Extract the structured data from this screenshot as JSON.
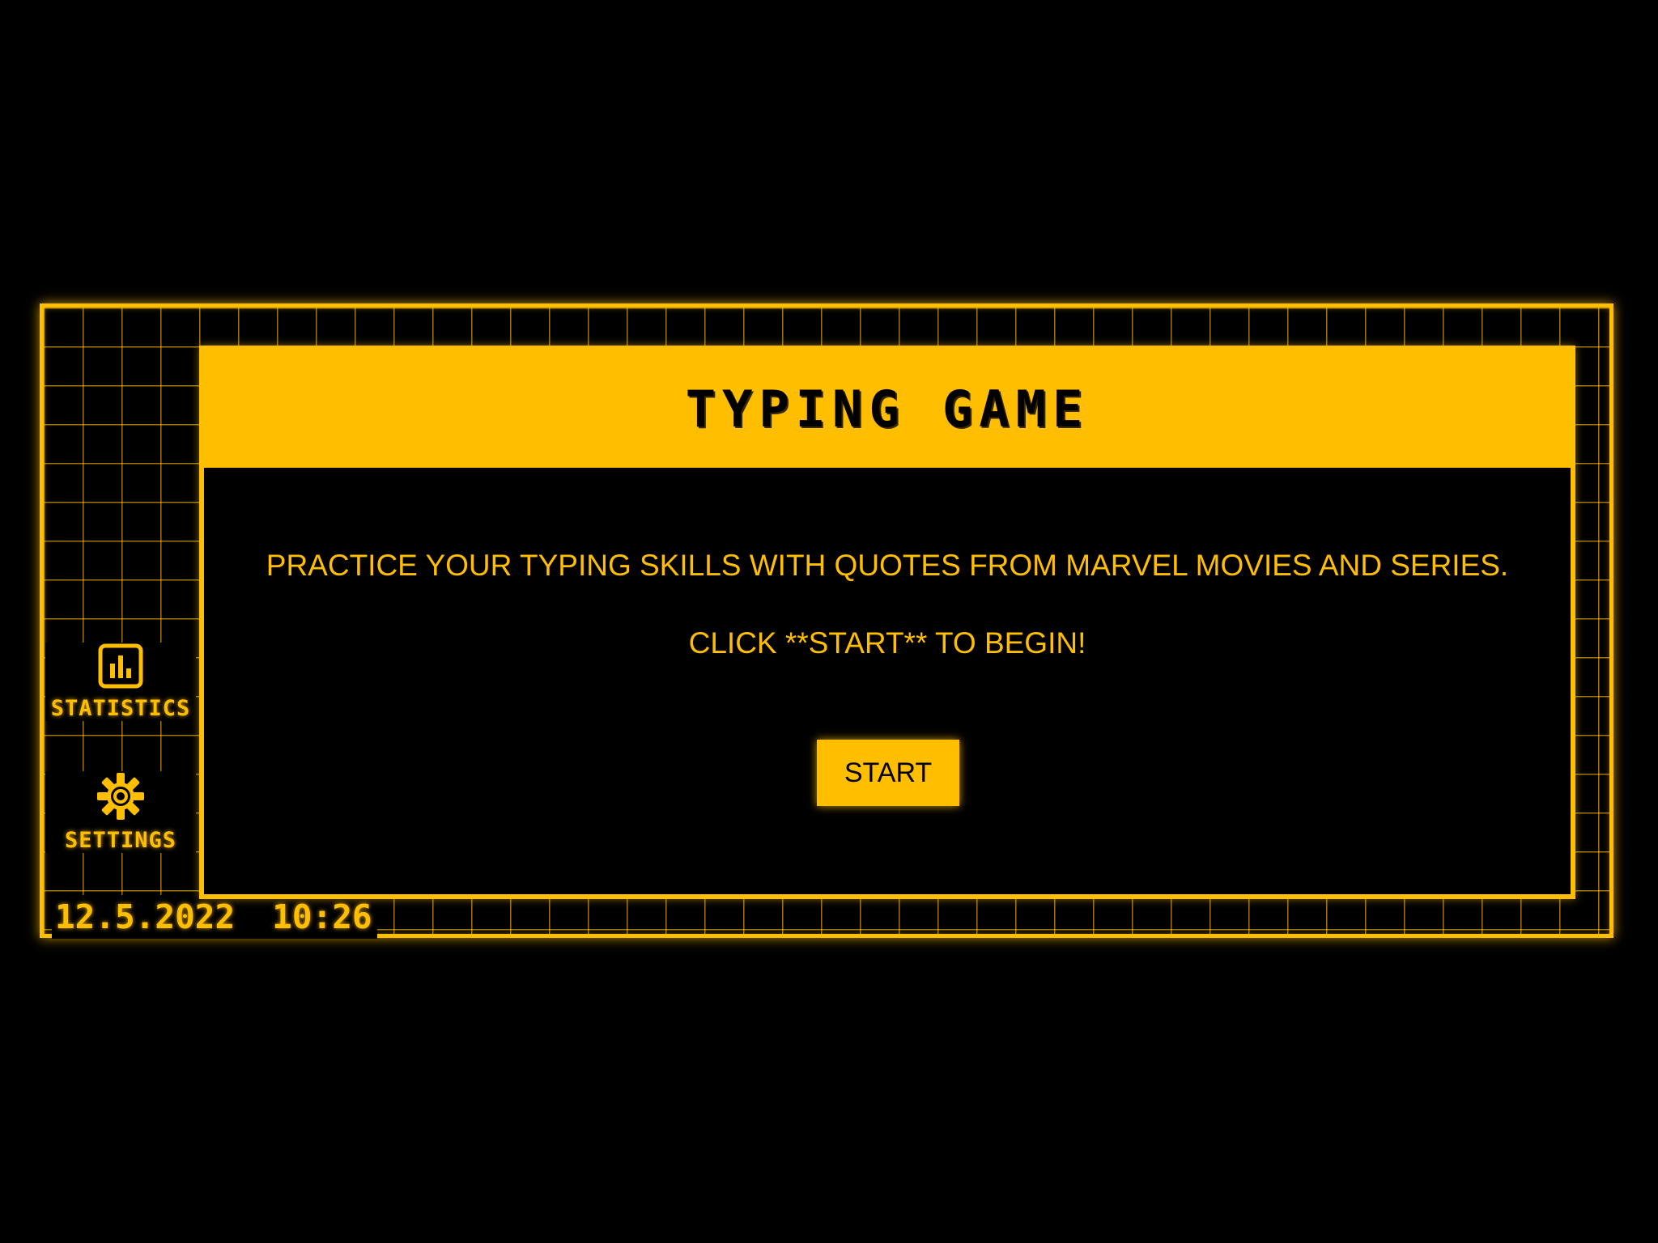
{
  "game": {
    "title": "TYPING GAME",
    "description": "PRACTICE YOUR TYPING SKILLS WITH QUOTES FROM MARVEL MOVIES AND SERIES.",
    "instruction": "CLICK **START** TO BEGIN!",
    "start_label": "START"
  },
  "sidebar": {
    "items": [
      {
        "label": "STATISTICS",
        "icon": "bar-chart-icon"
      },
      {
        "label": "SETTINGS",
        "icon": "gear-icon"
      }
    ]
  },
  "status": {
    "date": "12.5.2022",
    "time": "10:26"
  },
  "colors": {
    "accent": "#FFBF00",
    "background": "#000000"
  }
}
